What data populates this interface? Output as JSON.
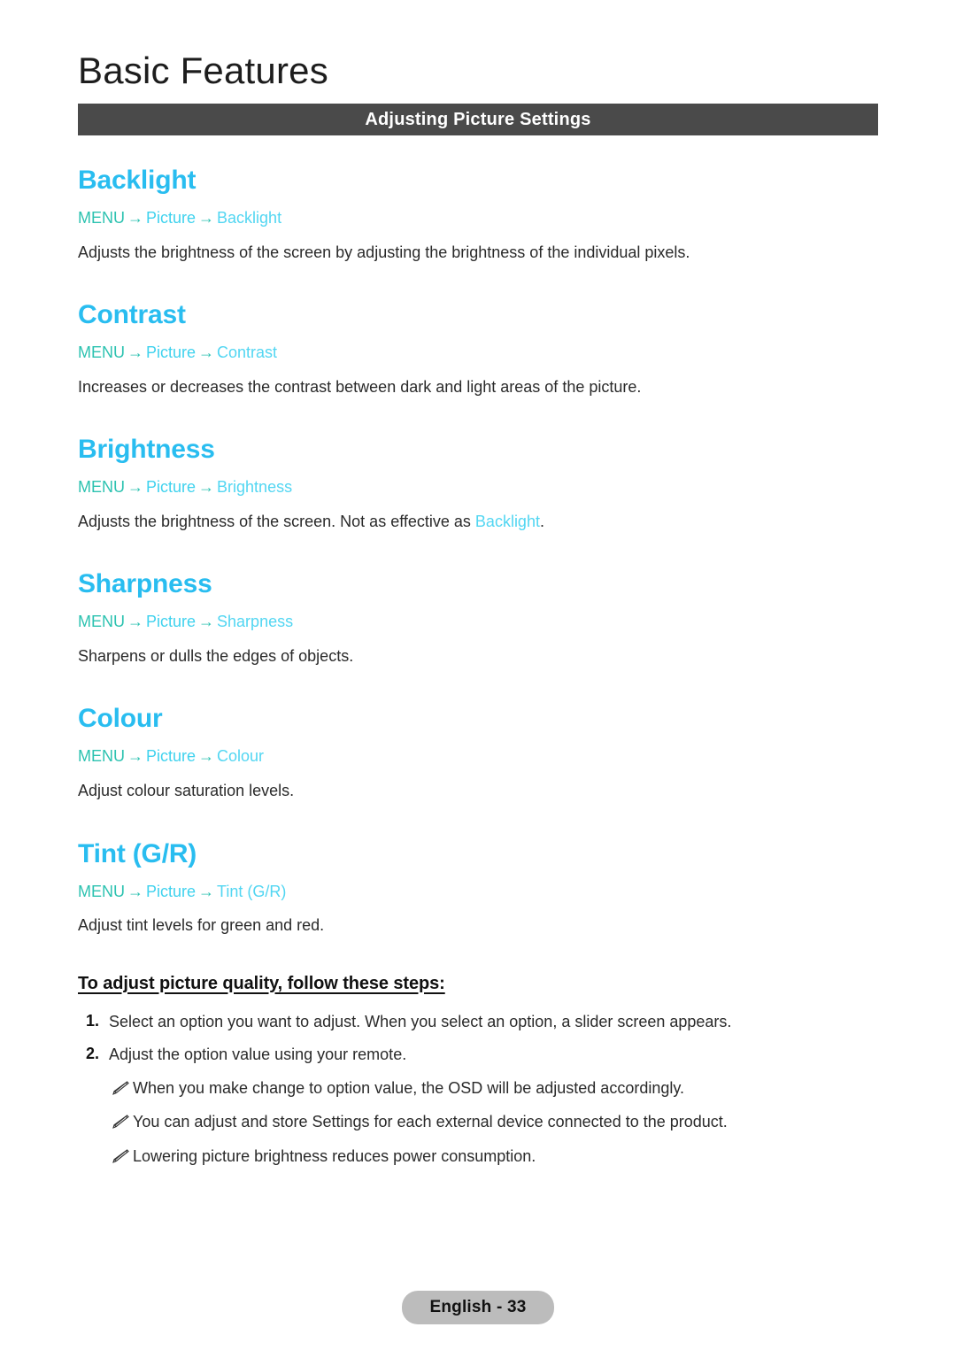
{
  "header": {
    "title": "Basic Features",
    "banner_label": "Adjusting Picture Settings"
  },
  "colors": {
    "heading_blue": "#29bdf0",
    "breadcrumb_menu_teal": "#2cc2b0",
    "breadcrumb_cyan": "#3fd2ee",
    "breadcrumb_leaf": "#52d6f2",
    "banner_background": "#4a4a4a",
    "footer_pill": "#bcbcbc",
    "body_text": "#2a2a2a"
  },
  "features": [
    {
      "heading": "Backlight",
      "breadcrumb": {
        "menu": "MENU",
        "arrow": "→",
        "middle": "Picture",
        "leaf": "Backlight"
      },
      "description_before": "Adjusts the brightness of the screen by adjusting the brightness of the individual pixels.",
      "description_ref": "",
      "description_after": ""
    },
    {
      "heading": "Contrast",
      "breadcrumb": {
        "menu": "MENU",
        "arrow": "→",
        "middle": "Picture",
        "leaf": "Contrast"
      },
      "description_before": "Increases or decreases the contrast between dark and light areas of the picture.",
      "description_ref": "",
      "description_after": ""
    },
    {
      "heading": "Brightness",
      "breadcrumb": {
        "menu": "MENU",
        "arrow": "→",
        "middle": "Picture",
        "leaf": "Brightness"
      },
      "description_before": "Adjusts the brightness of the screen. Not as effective as ",
      "description_ref": "Backlight",
      "description_after": "."
    },
    {
      "heading": "Sharpness",
      "breadcrumb": {
        "menu": "MENU",
        "arrow": "→",
        "middle": "Picture",
        "leaf": "Sharpness"
      },
      "description_before": "Sharpens or dulls the edges of objects.",
      "description_ref": "",
      "description_after": ""
    },
    {
      "heading": "Colour",
      "breadcrumb": {
        "menu": "MENU",
        "arrow": "→",
        "middle": "Picture",
        "leaf": "Colour"
      },
      "description_before": "Adjust colour saturation levels.",
      "description_ref": "",
      "description_after": ""
    },
    {
      "heading": "Tint (G/R)",
      "breadcrumb": {
        "menu": "MENU",
        "arrow": "→",
        "middle": "Picture",
        "leaf": "Tint (G/R)"
      },
      "description_before": "Adjust tint levels for green and red.",
      "description_ref": "",
      "description_after": ""
    }
  ],
  "steps_block": {
    "title": "To adjust picture quality, follow these steps:",
    "steps": [
      {
        "number": "1.",
        "text": "Select an option you want to adjust. When you select an option, a slider screen appears."
      },
      {
        "number": "2.",
        "text": "Adjust the option value using your remote."
      }
    ],
    "notes": [
      {
        "icon": "pencil-note-icon",
        "text": "When you make change to option value, the OSD will be adjusted accordingly."
      },
      {
        "icon": "pencil-note-icon",
        "text": "You can adjust and store Settings for each external device connected to the product."
      },
      {
        "icon": "pencil-note-icon",
        "text": "Lowering picture brightness reduces power consumption."
      }
    ]
  },
  "footer": {
    "label": "English - 33"
  }
}
